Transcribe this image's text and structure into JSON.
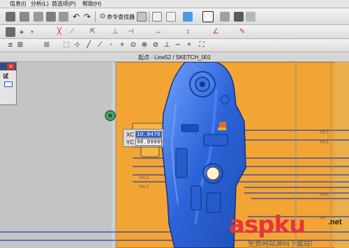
{
  "menu": {
    "items": [
      "信息(I)",
      "分析(L)",
      "首选项(P)",
      "帮助(H)"
    ]
  },
  "toolbar": {
    "command_finder_label": "命令查找器"
  },
  "document": {
    "title": "起点 - Line52 / SKETCH_001"
  },
  "side_panel": {
    "label": "试"
  },
  "coordinates": {
    "xc_label": "XC",
    "xc_value": "10.9470",
    "yc_label": "YC",
    "yc_value": "98.99995"
  },
  "viewport": {
    "dimension_labels": [
      "R4.5",
      "R4.5",
      "R4.5",
      "R4.5",
      "R4.5",
      "R4"
    ]
  },
  "watermark": {
    "main": "aspku",
    "suffix": ".net",
    "sub": "免费网站源码下载站!"
  },
  "colors": {
    "model_blue": "#2c63d8",
    "mold_orange": "#f2a534",
    "sketch_line": "#2541b2",
    "watermark_red": "#e8343f"
  },
  "icons": {
    "toolbar1": [
      "new-icon",
      "open-icon",
      "scissors-icon",
      "copy-icon",
      "paste-icon",
      "delete-icon",
      "undo-icon",
      "redo-icon",
      "binoculars-icon",
      "select-filter-icon",
      "cube-icon",
      "render-style-icon",
      "view-icon"
    ],
    "toolbar2": [
      "sketch-icon",
      "add-icon",
      "arc-icon",
      "trim-icon",
      "constraint-icon",
      "dimension-icon",
      "edit-icon"
    ],
    "toolbar3": [
      "menu-icon",
      "snap-icon",
      "grid-icon",
      "point-icon",
      "line-snap-icon"
    ]
  }
}
